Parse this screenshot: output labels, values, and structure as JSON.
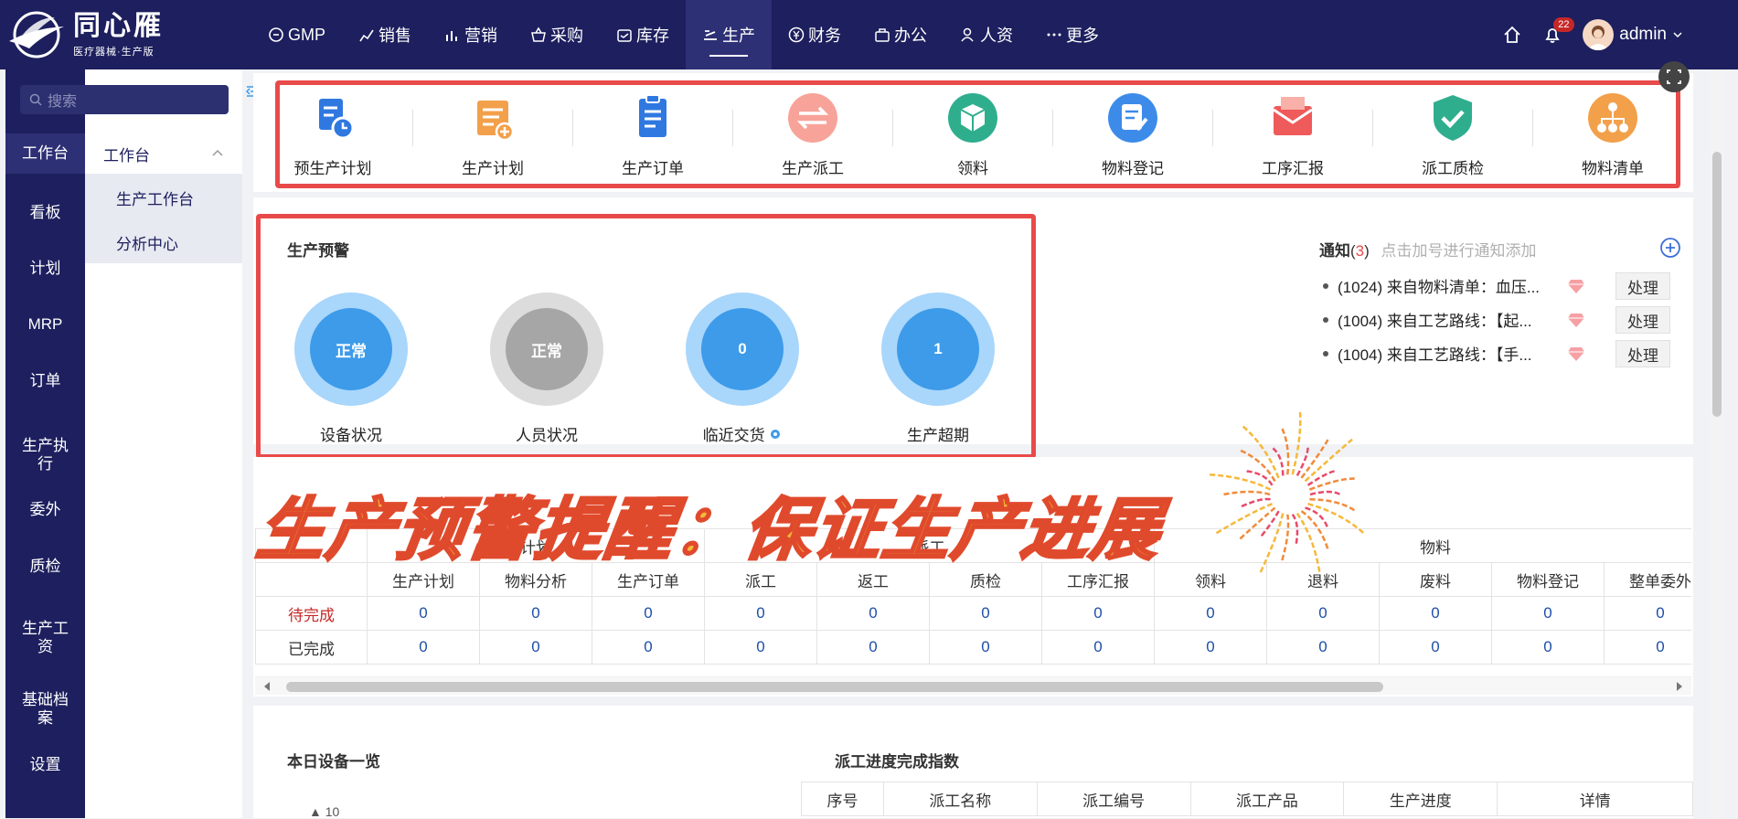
{
  "header": {
    "brand": "同心雁",
    "brand_sub": "医疗器械·生产版",
    "nav": [
      {
        "label": "GMP",
        "icon": "gmp-icon"
      },
      {
        "label": "销售",
        "icon": "sales-chart-icon"
      },
      {
        "label": "营销",
        "icon": "bar-chart-icon"
      },
      {
        "label": "采购",
        "icon": "basket-icon"
      },
      {
        "label": "库存",
        "icon": "inventory-icon"
      },
      {
        "label": "生产",
        "icon": "production-icon"
      },
      {
        "label": "财务",
        "icon": "yen-icon"
      },
      {
        "label": "办公",
        "icon": "briefcase-icon"
      },
      {
        "label": "人资",
        "icon": "person-icon"
      },
      {
        "label": "更多",
        "icon": "more-icon"
      }
    ],
    "active_nav": "生产",
    "notification_count": "22",
    "username": "admin"
  },
  "sidebar": {
    "search_placeholder": "搜索",
    "items": [
      "工作台",
      "看板",
      "计划",
      "MRP",
      "订单",
      "生产执行",
      "委外",
      "质检",
      "生产工资",
      "基础档案",
      "设置"
    ],
    "submenu_title": "工作台",
    "submenu_items": [
      "生产工作台",
      "分析中心"
    ]
  },
  "quick_actions": [
    "预生产计划",
    "生产计划",
    "生产订单",
    "生产派工",
    "领料",
    "物料登记",
    "工序汇报",
    "派工质检",
    "物料清单"
  ],
  "warning": {
    "title": "生产预警",
    "gauges": [
      {
        "label": "设备状况",
        "value": "正常",
        "color": "#3d9be9"
      },
      {
        "label": "人员状况",
        "value": "正常",
        "color": "#a6a6a6"
      },
      {
        "label": "临近交货",
        "value": "0",
        "color": "#3d9be9"
      },
      {
        "label": "生产超期",
        "value": "1",
        "color": "#3d9be9"
      }
    ]
  },
  "notice": {
    "title": "通知",
    "count": "3",
    "hint": "点击加号进行通知添加",
    "items": [
      "(1024) 来自物料清单：血压...",
      "(1004) 来自工艺路线：【起...",
      "(1004) 来自工艺路线：【手..."
    ],
    "action_label": "处理"
  },
  "banner": "生产预警提醒：保证生产进展",
  "status_table": {
    "groups": [
      "计划",
      "派工",
      "物料"
    ],
    "columns": [
      "生产计划",
      "物料分析",
      "生产订单",
      "派工",
      "返工",
      "质检",
      "工序汇报",
      "领料",
      "退料",
      "废料",
      "物料登记",
      "整单委外"
    ],
    "rows": [
      {
        "label": "待完成",
        "values": [
          "0",
          "0",
          "0",
          "0",
          "0",
          "0",
          "0",
          "0",
          "0",
          "0",
          "0",
          "0"
        ]
      },
      {
        "label": "已完成",
        "values": [
          "0",
          "0",
          "0",
          "0",
          "0",
          "0",
          "0",
          "0",
          "0",
          "0",
          "0",
          "0"
        ]
      }
    ]
  },
  "device_title": "本日设备一览",
  "device_axis_top": "10",
  "dispatch": {
    "title": "派工进度完成指数",
    "columns": [
      "序号",
      "派工名称",
      "派工编号",
      "派工产品",
      "生产进度",
      "详情"
    ]
  },
  "colors": {
    "nav_bg": "#1d1f5e",
    "highlight": "#e84a4a",
    "pending": "#c62828"
  }
}
